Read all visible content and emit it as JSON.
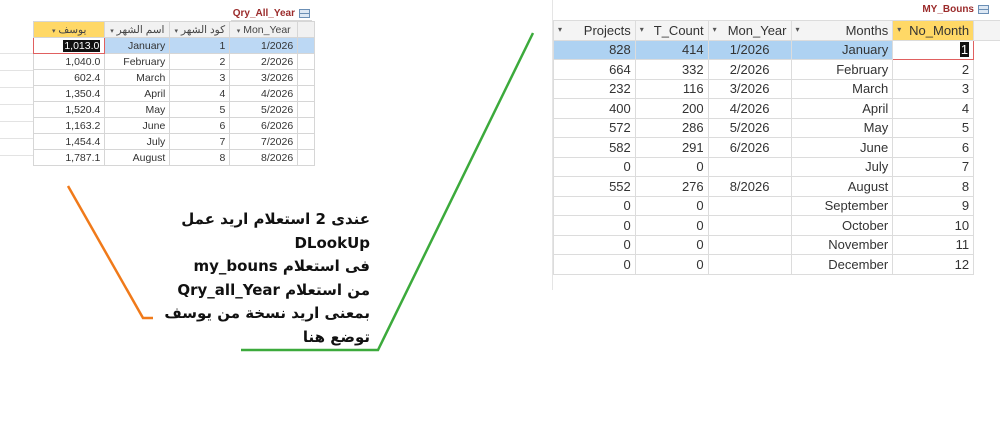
{
  "left_table": {
    "tab_title": "Qry_All_Year",
    "columns": [
      "يوسف",
      "اسم الشهر",
      "كود الشهر",
      "Mon_Year"
    ],
    "rows": [
      {
        "yousef": "1,013.0",
        "month_name": "January",
        "month_code": "1",
        "mon_year": "1/2026"
      },
      {
        "yousef": "1,040.0",
        "month_name": "February",
        "month_code": "2",
        "mon_year": "2/2026"
      },
      {
        "yousef": "602.4",
        "month_name": "March",
        "month_code": "3",
        "mon_year": "3/2026"
      },
      {
        "yousef": "1,350.4",
        "month_name": "April",
        "month_code": "4",
        "mon_year": "4/2026"
      },
      {
        "yousef": "1,520.4",
        "month_name": "May",
        "month_code": "5",
        "mon_year": "5/2026"
      },
      {
        "yousef": "1,163.2",
        "month_name": "June",
        "month_code": "6",
        "mon_year": "6/2026"
      },
      {
        "yousef": "1,454.4",
        "month_name": "July",
        "month_code": "7",
        "mon_year": "7/2026"
      },
      {
        "yousef": "1,787.1",
        "month_name": "August",
        "month_code": "8",
        "mon_year": "8/2026"
      }
    ]
  },
  "right_table": {
    "tab_title": "MY_Bouns",
    "columns": [
      "Projects",
      "T_Count",
      "Mon_Year",
      "Months",
      "No_Month"
    ],
    "rows": [
      {
        "projects": "828",
        "t_count": "414",
        "mon_year": "1/2026",
        "months": "January",
        "no_month": "1"
      },
      {
        "projects": "664",
        "t_count": "332",
        "mon_year": "2/2026",
        "months": "February",
        "no_month": "2"
      },
      {
        "projects": "232",
        "t_count": "116",
        "mon_year": "3/2026",
        "months": "March",
        "no_month": "3"
      },
      {
        "projects": "400",
        "t_count": "200",
        "mon_year": "4/2026",
        "months": "April",
        "no_month": "4"
      },
      {
        "projects": "572",
        "t_count": "286",
        "mon_year": "5/2026",
        "months": "May",
        "no_month": "5"
      },
      {
        "projects": "582",
        "t_count": "291",
        "mon_year": "6/2026",
        "months": "June",
        "no_month": "6"
      },
      {
        "projects": "0",
        "t_count": "0",
        "mon_year": "",
        "months": "July",
        "no_month": "7"
      },
      {
        "projects": "552",
        "t_count": "276",
        "mon_year": "8/2026",
        "months": "August",
        "no_month": "8"
      },
      {
        "projects": "0",
        "t_count": "0",
        "mon_year": "",
        "months": "September",
        "no_month": "9"
      },
      {
        "projects": "0",
        "t_count": "0",
        "mon_year": "",
        "months": "October",
        "no_month": "10"
      },
      {
        "projects": "0",
        "t_count": "0",
        "mon_year": "",
        "months": "November",
        "no_month": "11"
      },
      {
        "projects": "0",
        "t_count": "0",
        "mon_year": "",
        "months": "December",
        "no_month": "12"
      }
    ]
  },
  "annotation": {
    "lines": [
      "عندى 2 استعلام اريد عمل",
      "DLookUp",
      "فى استعلام my_bouns",
      "من استعلام Qry_all_Year",
      "بمعنى اريد نسخة من يوسف",
      "توضع هنا"
    ]
  },
  "colors": {
    "orange_arrow": "#f07a1a",
    "green_arrow": "#3caa3c",
    "header_highlight": "#ffd866",
    "selected_row": "#aed2f2",
    "tab_title": "#9b2b2b"
  },
  "icons": {
    "table_tab": "datasheet-icon",
    "column_menu": "dropdown-caret-icon"
  }
}
